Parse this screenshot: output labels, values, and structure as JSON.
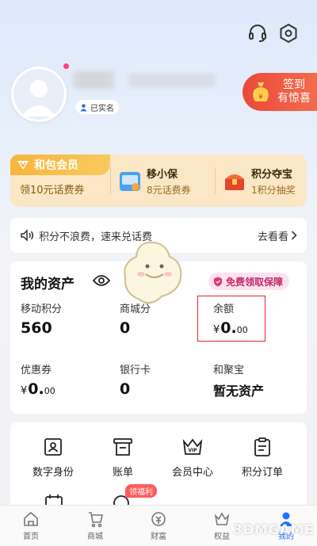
{
  "profile": {
    "realname_label": "已实名"
  },
  "signin": {
    "line1": "签到",
    "line2": "有惊喜"
  },
  "member": {
    "title": "和包会员",
    "subtitle": "领10元话费券",
    "items": [
      {
        "title": "移小保",
        "desc": "8元话费券",
        "icon": "insurance-icon"
      },
      {
        "title": "积分夺宝",
        "desc": "1积分抽奖",
        "icon": "treasure-chest-icon"
      }
    ]
  },
  "notice": {
    "text": "积分不浪费，速来兑话费",
    "action": "去看看"
  },
  "assets": {
    "title": "我的资产",
    "protect_label": "免费领取保障",
    "cells": [
      {
        "label": "移动积分",
        "value": "560"
      },
      {
        "label": "商城分",
        "value": "0"
      },
      {
        "label": "余额",
        "currency": "¥",
        "int": "0.",
        "dec": "00"
      },
      {
        "label": "优惠券",
        "currency": "¥",
        "int": "0.",
        "dec": "00"
      },
      {
        "label": "银行卡",
        "value": "0"
      },
      {
        "label": "和聚宝",
        "value": "暂无资产"
      }
    ]
  },
  "services": [
    {
      "label": "数字身份",
      "icon": "id-card-icon"
    },
    {
      "label": "账单",
      "icon": "bill-icon"
    },
    {
      "label": "会员中心",
      "icon": "vip-crown-icon"
    },
    {
      "label": "积分订单",
      "icon": "order-icon"
    }
  ],
  "service_badge": "领福利",
  "nav": [
    {
      "label": "首页",
      "icon": "home-icon"
    },
    {
      "label": "商城",
      "icon": "mall-icon"
    },
    {
      "label": "财富",
      "icon": "wealth-icon"
    },
    {
      "label": "权益",
      "icon": "rights-icon"
    },
    {
      "label": "我的",
      "icon": "user-icon"
    }
  ],
  "watermark": "3DMGAME",
  "colors": {
    "accent_red": "#e0242b",
    "gold": "#f7b53a",
    "pink": "#c22a6b",
    "active_nav": "#1f6fff"
  }
}
